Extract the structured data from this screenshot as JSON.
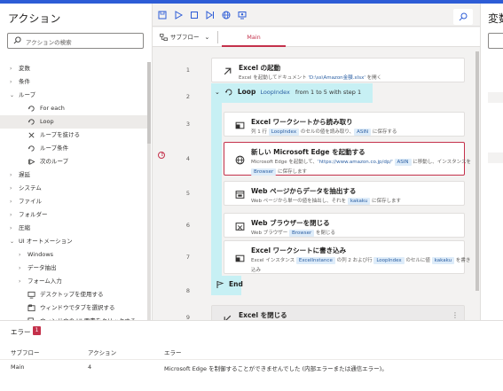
{
  "actions_pane": {
    "title": "アクション",
    "search_placeholder": "アクションの検索",
    "tree": [
      {
        "label": "変数",
        "level": 0,
        "type": "group"
      },
      {
        "label": "条件",
        "level": 0,
        "type": "group"
      },
      {
        "label": "ループ",
        "level": 0,
        "type": "group-open"
      },
      {
        "label": "For each",
        "level": 1,
        "type": "item",
        "icon": "loop-icon"
      },
      {
        "label": "Loop",
        "level": 1,
        "type": "item",
        "icon": "loop-icon",
        "selected": true
      },
      {
        "label": "ループを抜ける",
        "level": 1,
        "type": "item",
        "icon": "exit-loop-icon"
      },
      {
        "label": "ループ条件",
        "level": 1,
        "type": "item",
        "icon": "loop-icon"
      },
      {
        "label": "次のループ",
        "level": 1,
        "type": "item",
        "icon": "next-loop-icon"
      },
      {
        "label": "遅延",
        "level": 0,
        "type": "group"
      },
      {
        "label": "システム",
        "level": 0,
        "type": "group"
      },
      {
        "label": "ファイル",
        "level": 0,
        "type": "group"
      },
      {
        "label": "フォルダー",
        "level": 0,
        "type": "group"
      },
      {
        "label": "圧縮",
        "level": 0,
        "type": "group"
      },
      {
        "label": "UI オートメーション",
        "level": 0,
        "type": "group-open"
      },
      {
        "label": "Windows",
        "level": 1,
        "type": "group"
      },
      {
        "label": "データ抽出",
        "level": 1,
        "type": "group"
      },
      {
        "label": "フォーム入力",
        "level": 1,
        "type": "group"
      },
      {
        "label": "デスクトップを使用する",
        "level": 1,
        "type": "item",
        "icon": "desktop-icon"
      },
      {
        "label": "ウィンドウでタブを選択する",
        "level": 1,
        "type": "item",
        "icon": "window-tab-icon"
      },
      {
        "label": "ウィンドウの UI 要素をクリックする",
        "level": 1,
        "type": "item",
        "icon": "click-element-icon"
      }
    ]
  },
  "designer": {
    "subflow_label": "サブフロー",
    "tab_main": "Main",
    "steps": [
      {
        "num": "1",
        "title": "Excel の起動",
        "desc": [
          "Excel を起動してドキュメント ",
          {
            "s": "'D:\\ss\\Amazon金額.xlsx'"
          },
          " を開く"
        ]
      },
      {
        "num": "2",
        "title": "Loop",
        "loop_var": "LoopIndex",
        "loop_text": "from 1 to 5 with step 1"
      },
      {
        "num": "3",
        "title": "Excel ワークシートから読み取り",
        "desc": [
          "列 1 行 ",
          {
            "t": "LoopIndex"
          },
          " のセルの値を読み取り、",
          {
            "t": "ASIN"
          },
          " に保存する"
        ]
      },
      {
        "num": "4",
        "title": "新しい Microsoft Edge を起動する",
        "desc": [
          "Microsoft Edge を起動して、",
          {
            "s": "'https://www.amazon.co.jp/dp/'"
          },
          " ",
          {
            "t": "ASIN"
          },
          " に移動し、インスタンスを ",
          {
            "t": "Browser"
          },
          " に保存します"
        ],
        "error": true
      },
      {
        "num": "5",
        "title": "Web ページからデータを抽出する",
        "desc": [
          "Web ページから単一の値を抽出し、それを ",
          {
            "t": "kakaku"
          },
          " に保存します"
        ]
      },
      {
        "num": "6",
        "title": "Web ブラウザーを閉じる",
        "desc": [
          "Web ブラウザー ",
          {
            "t": "Browser"
          },
          " を閉じる"
        ]
      },
      {
        "num": "7",
        "title": "Excel ワークシートに書き込み",
        "desc": [
          "Excel インスタンス ",
          {
            "t": "ExcelInstance"
          },
          " の列 2 および行 ",
          {
            "t": "LoopIndex"
          },
          " のセルに値 ",
          {
            "t": "kakaku"
          },
          " を書き込み"
        ]
      },
      {
        "num": "8",
        "title": "End"
      },
      {
        "num": "9",
        "title": "Excel を閉じる",
        "desc": [
          "Excel ドキュメントを保存して Excel インスタンス ",
          {
            "t": "ExcelInstance"
          },
          " を閉じる"
        ]
      }
    ]
  },
  "variables_pane": {
    "title": "変数"
  },
  "error_panel": {
    "title": "エラー",
    "count": "1",
    "columns": [
      "サブフロー",
      "アクション",
      "エラー"
    ],
    "rows": [
      {
        "subflow": "Main",
        "action": "4",
        "error": "Microsoft Edge を制御することができませんでした (内部エラーまたは通信エラー)。"
      }
    ]
  },
  "colors": {
    "accent": "#c4314b",
    "loop_fill": "#c7f0f4",
    "token_bg": "#deecf9",
    "top_strip": "#2d5cd6"
  }
}
